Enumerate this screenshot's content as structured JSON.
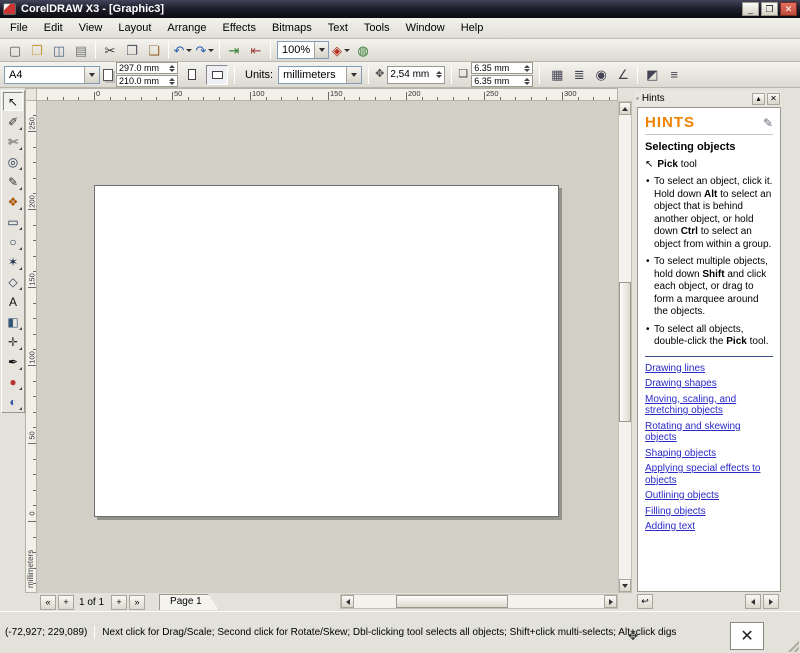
{
  "colors": {
    "titlebar_start": "#44445c",
    "titlebar_end": "#0a0a10",
    "close_button": "#c04a3a",
    "hints_header": "#ef8200",
    "link": "#2a2ac8",
    "divider_navy": "#3c4a86",
    "canvas": "#d2cfc7",
    "page": "#ffffff"
  },
  "window": {
    "title": "CorelDRAW X3 - [Graphic3]",
    "controls": [
      {
        "name": "minimize",
        "glyph": "_"
      },
      {
        "name": "restore",
        "glyph": "❐"
      },
      {
        "name": "close",
        "glyph": "✕"
      }
    ]
  },
  "menubar": {
    "items": [
      "File",
      "Edit",
      "View",
      "Layout",
      "Arrange",
      "Effects",
      "Bitmaps",
      "Text",
      "Tools",
      "Window",
      "Help"
    ]
  },
  "standard_toolbar": {
    "buttons": [
      {
        "name": "new",
        "glyph": "▢",
        "color": "#555555"
      },
      {
        "name": "open",
        "glyph": "❒",
        "color": "#c89b3c"
      },
      {
        "name": "save",
        "glyph": "◫",
        "color": "#55678f"
      },
      {
        "name": "print",
        "glyph": "▤",
        "color": "#777777"
      },
      {
        "sep": true
      },
      {
        "name": "cut",
        "glyph": "✂",
        "color": "#333333"
      },
      {
        "name": "copy",
        "glyph": "❐",
        "color": "#555566"
      },
      {
        "name": "paste",
        "glyph": "❏",
        "color": "#996633"
      },
      {
        "sep": true
      },
      {
        "name": "undo",
        "glyph": "↶",
        "color": "#2f5fae",
        "dropdown": true
      },
      {
        "name": "redo",
        "glyph": "↷",
        "color": "#2f5fae",
        "dropdown": true
      },
      {
        "sep": true
      },
      {
        "name": "import",
        "glyph": "⇥",
        "color": "#2f7a2f"
      },
      {
        "name": "export",
        "glyph": "⇤",
        "color": "#a04040"
      },
      {
        "sep": true
      }
    ],
    "zoom_value": "100%",
    "after_buttons": [
      {
        "name": "application-launcher",
        "glyph": "◈",
        "color": "#b23322",
        "dropdown": true
      },
      {
        "name": "corel-online",
        "glyph": "◍",
        "color": "#2f7a2f"
      }
    ]
  },
  "property_bar": {
    "paper_type": "A4",
    "paper_width": "297.0 mm",
    "paper_height": "210.0 mm",
    "units_label": "Units:",
    "units": "millimeters",
    "nudge_offset": "2,54 mm",
    "duplicate_x": "6.35 mm",
    "duplicate_y": "6.35 mm",
    "right_buttons": [
      {
        "name": "snap-to-grid",
        "glyph": "▦",
        "color": "#444455"
      },
      {
        "name": "snap-to-guidelines",
        "glyph": "≣",
        "color": "#444455"
      },
      {
        "name": "snap-to-objects",
        "glyph": "◉",
        "color": "#444455"
      },
      {
        "name": "dynamic-guides",
        "glyph": "∠",
        "color": "#444455"
      },
      {
        "sep": true
      },
      {
        "name": "treat-as-filled",
        "glyph": "◩",
        "color": "#444455"
      },
      {
        "name": "options",
        "glyph": "≡",
        "color": "#444455"
      }
    ]
  },
  "toolbox": {
    "tools": [
      {
        "name": "pick-tool",
        "glyph": "↖",
        "color": "#111111",
        "active": true
      },
      {
        "name": "shape-tool",
        "glyph": "✐",
        "color": "#333333",
        "flyout": true
      },
      {
        "name": "crop-tool",
        "glyph": "✄",
        "color": "#333333",
        "flyout": true
      },
      {
        "name": "zoom-tool",
        "glyph": "◎",
        "color": "#223355",
        "flyout": true
      },
      {
        "name": "freehand-tool",
        "glyph": "✎",
        "color": "#333333",
        "flyout": true
      },
      {
        "name": "smart-fill-tool",
        "glyph": "❖",
        "color": "#aa5500",
        "flyout": true
      },
      {
        "name": "rectangle-tool",
        "glyph": "▭",
        "color": "#223355",
        "flyout": true
      },
      {
        "name": "ellipse-tool",
        "glyph": "○",
        "color": "#223355",
        "flyout": true
      },
      {
        "name": "polygon-tool",
        "glyph": "✶",
        "color": "#223355",
        "flyout": true
      },
      {
        "name": "basic-shapes-tool",
        "glyph": "◇",
        "color": "#223355",
        "flyout": true
      },
      {
        "name": "text-tool",
        "glyph": "A",
        "color": "#111111"
      },
      {
        "name": "interactive-blend-tool",
        "glyph": "◧",
        "color": "#335577",
        "flyout": true
      },
      {
        "name": "eyedropper-tool",
        "glyph": "✛",
        "color": "#333333",
        "flyout": true
      },
      {
        "name": "outline-tool",
        "glyph": "✒",
        "color": "#111111",
        "flyout": true
      },
      {
        "name": "fill-tool",
        "glyph": "●",
        "color": "#bb3333",
        "flyout": true
      },
      {
        "name": "interactive-fill-tool",
        "glyph": "◐",
        "color": "#3355aa",
        "flyout": true
      }
    ]
  },
  "rulers": {
    "horizontal_labels": [
      "0",
      "50",
      "100",
      "150",
      "200",
      "250",
      "300"
    ],
    "vertical_labels": [
      "250",
      "200",
      "150",
      "100",
      "50",
      "0"
    ],
    "units_caption": "millimeters"
  },
  "hints": {
    "docker_title": "Hints",
    "collapse_glyph": "▴",
    "close_glyph": "✕",
    "header": "HINTS",
    "section_title": "Selecting objects",
    "tool_bold": "Pick",
    "tool_rest": " tool",
    "bullets": [
      [
        {
          "t": "To select an object, click it. Hold down "
        },
        {
          "t": "Alt",
          "b": true
        },
        {
          "t": " to select an object that is behind another object, or hold down "
        },
        {
          "t": "Ctrl",
          "b": true
        },
        {
          "t": " to select an object from within a group."
        }
      ],
      [
        {
          "t": "To select multiple objects, hold down "
        },
        {
          "t": "Shift",
          "b": true
        },
        {
          "t": " and click each object, or drag to form a marquee around the objects."
        }
      ],
      [
        {
          "t": "To select all objects, double-click the "
        },
        {
          "t": "Pick",
          "b": true
        },
        {
          "t": " tool."
        }
      ]
    ],
    "links": [
      "Drawing lines",
      "Drawing shapes",
      "Moving, scaling, and stretching objects",
      "Rotating and skewing objects",
      "Shaping objects",
      "Applying special effects to objects",
      "Outlining objects",
      "Filling objects",
      "Adding text"
    ]
  },
  "page_nav": {
    "buttons_left": [
      {
        "name": "first-page",
        "glyph": "«"
      },
      {
        "name": "add-page-before",
        "glyph": "+"
      }
    ],
    "label": "1 of 1",
    "buttons_right": [
      {
        "name": "add-page-after",
        "glyph": "+"
      },
      {
        "name": "last-page",
        "glyph": "»"
      }
    ],
    "tab": "Page 1"
  },
  "status_bar": {
    "coordinates": "(-72,927; 229,089)",
    "hint": "Next click for Drag/Scale; Second click for Rotate/Skew; Dbl-clicking tool selects all objects; Shift+click multi-selects; Alt+click digs"
  }
}
